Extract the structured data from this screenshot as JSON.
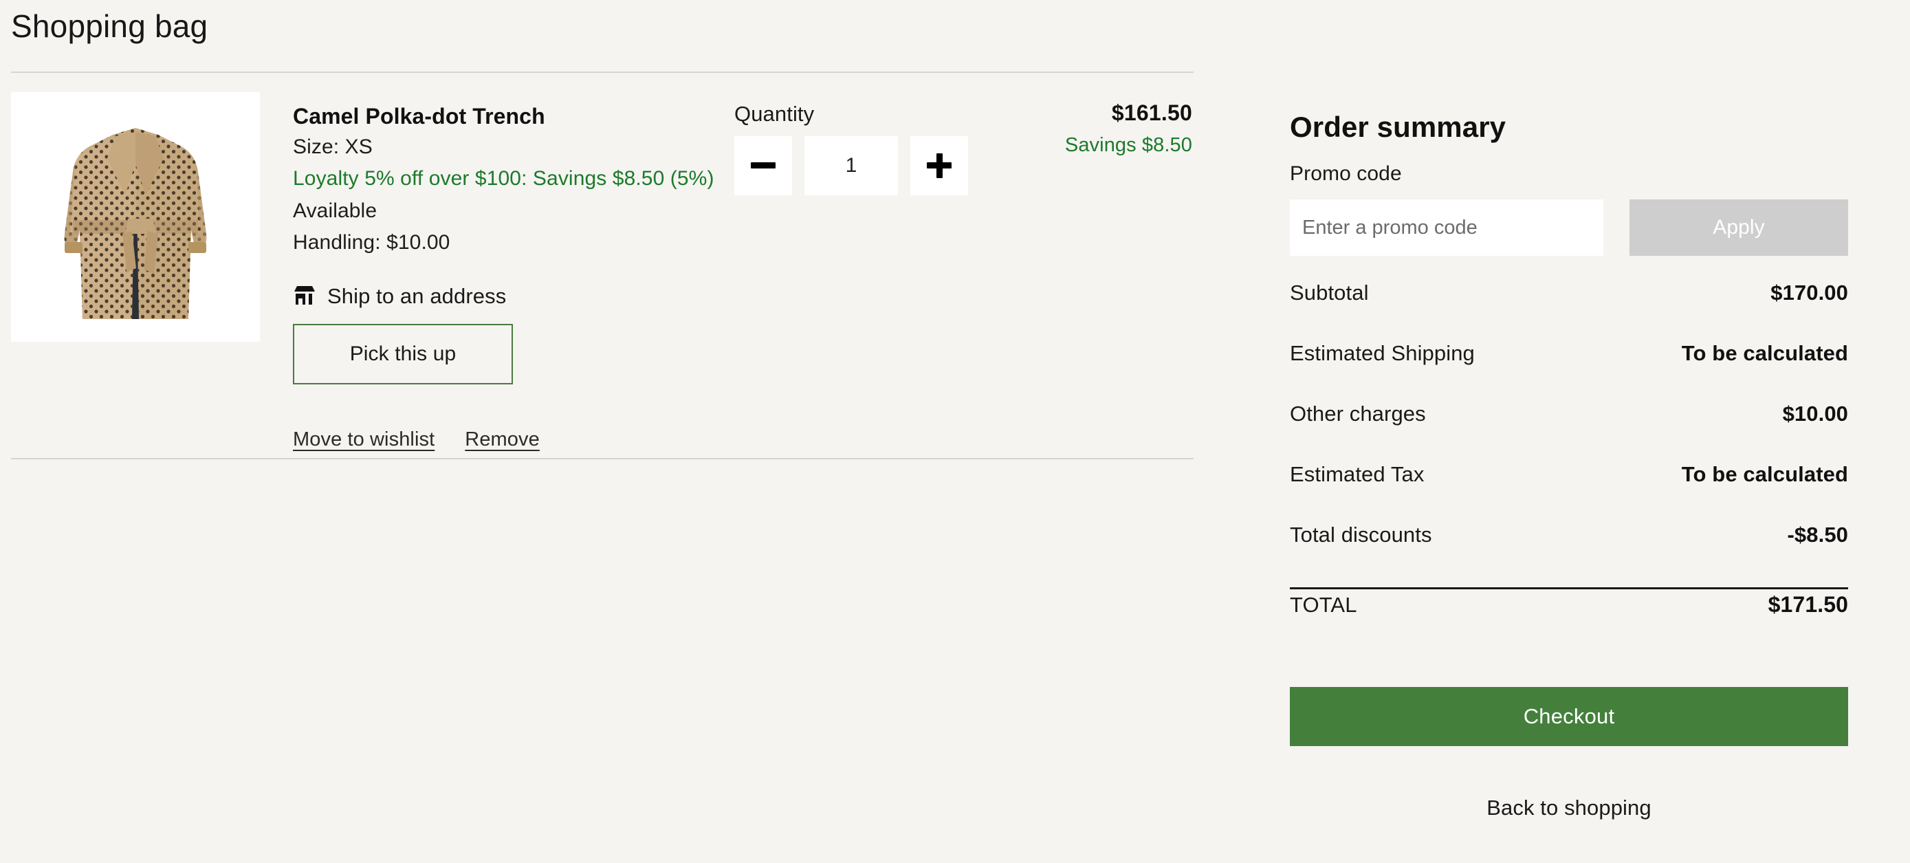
{
  "page": {
    "title": "Shopping bag",
    "background_color": "#f5f4f1",
    "accent_green": "#44803c",
    "savings_green": "#1d7a2b",
    "disabled_gray": "#cecece"
  },
  "cart": {
    "items": [
      {
        "name": "Camel Polka-dot Trench",
        "image_alt": "camel-polka-dot-trench-coat",
        "size_line": "Size: XS",
        "discount_line": "Loyalty 5% off over $100: Savings $8.50 (5%)",
        "availability": "Available",
        "handling": "Handling: $10.00",
        "fulfillment": {
          "icon": "store-icon",
          "label": "Ship to an address",
          "toggle_button": "Pick this up"
        },
        "quantity": {
          "label": "Quantity",
          "value": "1",
          "decrement_icon": "minus-icon",
          "increment_icon": "plus-icon"
        },
        "price": "$161.50",
        "savings": "Savings $8.50",
        "actions": {
          "wishlist": "Move to wishlist",
          "remove": "Remove"
        }
      }
    ]
  },
  "summary": {
    "title": "Order summary",
    "promo": {
      "label": "Promo code",
      "placeholder": "Enter a promo code",
      "value": "",
      "apply_label": "Apply",
      "apply_disabled": true
    },
    "rows": [
      {
        "key": "Subtotal",
        "value": "$170.00"
      },
      {
        "key": "Estimated Shipping",
        "value": "To be calculated"
      },
      {
        "key": "Other charges",
        "value": "$10.00"
      },
      {
        "key": "Estimated Tax",
        "value": "To be calculated"
      },
      {
        "key": "Total discounts",
        "value": "-$8.50"
      }
    ],
    "total": {
      "key": "TOTAL",
      "value": "$171.50"
    },
    "checkout_label": "Checkout",
    "back_label": "Back to shopping"
  }
}
